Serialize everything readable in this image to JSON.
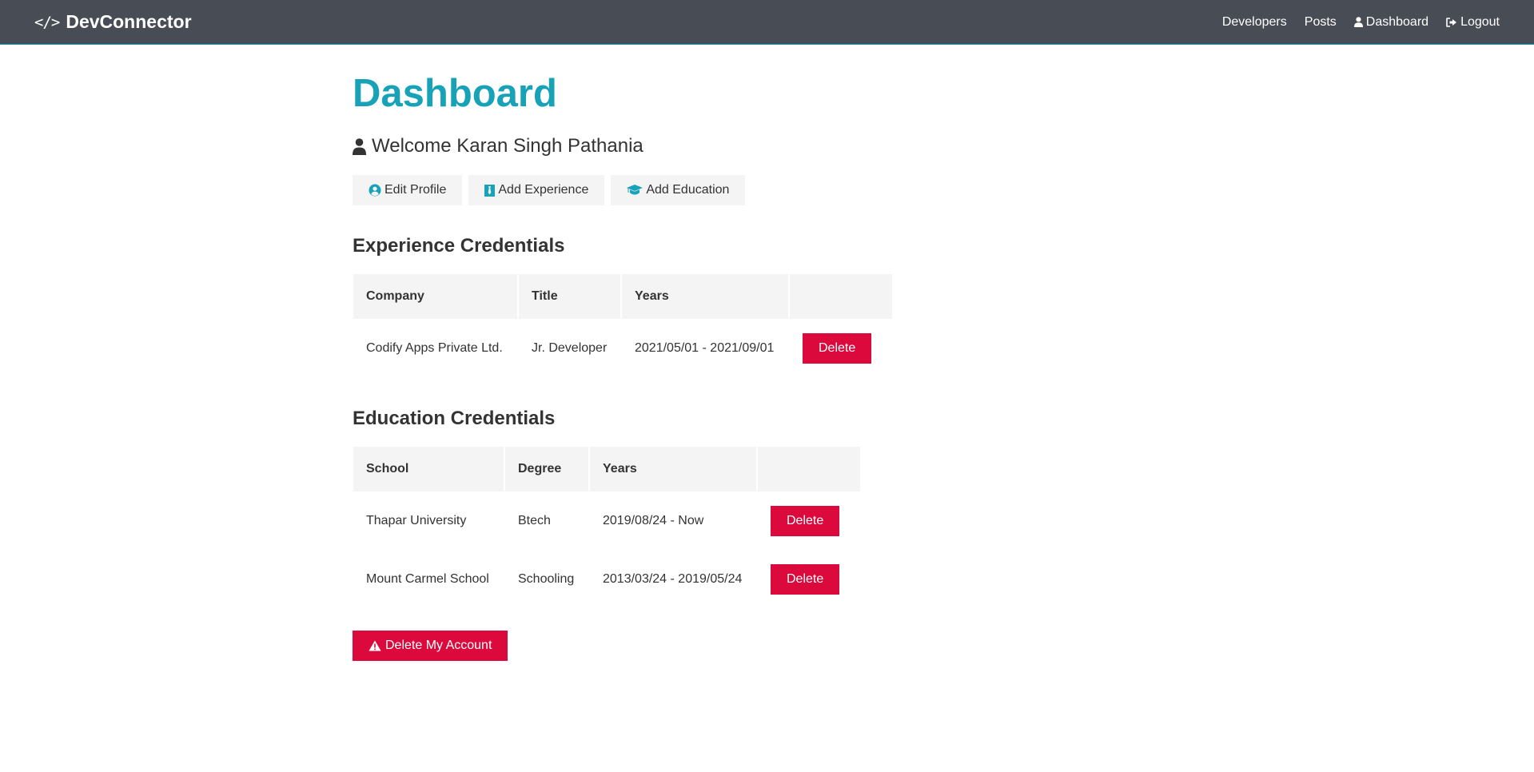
{
  "navbar": {
    "brand": "DevConnector",
    "links": {
      "developers": "Developers",
      "posts": "Posts",
      "dashboard": "Dashboard",
      "logout": "Logout"
    }
  },
  "page": {
    "title": "Dashboard",
    "welcome": "Welcome Karan Singh Pathania"
  },
  "actions": {
    "edit_profile": "Edit Profile",
    "add_experience": "Add Experience",
    "add_education": "Add Education"
  },
  "experience": {
    "title": "Experience Credentials",
    "headers": [
      "Company",
      "Title",
      "Years",
      ""
    ],
    "rows": [
      {
        "company": "Codify Apps Private Ltd.",
        "title": "Jr. Developer",
        "years": "2021/05/01 - 2021/09/01",
        "action": "Delete"
      }
    ]
  },
  "education": {
    "title": "Education Credentials",
    "headers": [
      "School",
      "Degree",
      "Years",
      ""
    ],
    "rows": [
      {
        "school": "Thapar University",
        "degree": "Btech",
        "years": "2019/08/24 - Now",
        "action": "Delete"
      },
      {
        "school": "Mount Carmel School",
        "degree": "Schooling",
        "years": "2013/03/24 - 2019/05/24",
        "action": "Delete"
      }
    ]
  },
  "delete_account": "Delete My Account",
  "colors": {
    "navbar_bg": "#484c54",
    "primary": "#17a2b8",
    "danger": "#dc0a3c",
    "light": "#f4f4f4",
    "text": "#333333"
  },
  "icons": {
    "brand": "code-icon",
    "dashboard": "user-icon",
    "logout": "sign-out-icon",
    "welcome": "user-icon",
    "edit_profile": "user-circle-icon",
    "add_experience": "black-tie-icon",
    "add_education": "graduation-cap-icon",
    "delete_account": "warning-icon"
  }
}
